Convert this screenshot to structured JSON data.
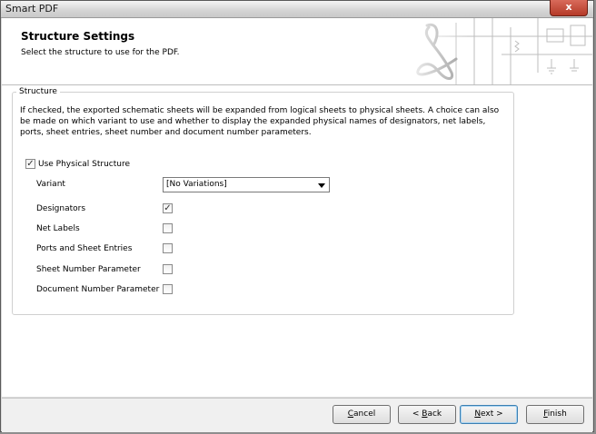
{
  "window": {
    "title": "Smart PDF",
    "close_label": "x"
  },
  "header": {
    "title": "Structure Settings",
    "subtitle": "Select the structure to use for the PDF."
  },
  "structure": {
    "legend": "Structure",
    "description": "If checked, the exported schematic sheets will be expanded from logical sheets to physical sheets. A choice can also be made on which variant to use and whether to display the expanded physical names of designators, net labels, ports, sheet entries, sheet number and document number parameters.",
    "use_physical": {
      "label": "Use Physical Structure",
      "checked": true
    },
    "variant": {
      "label": "Variant",
      "value": "[No Variations]"
    },
    "options": [
      {
        "label": "Designators",
        "checked": true
      },
      {
        "label": "Net Labels",
        "checked": false
      },
      {
        "label": "Ports and Sheet Entries",
        "checked": false
      },
      {
        "label": "Sheet Number Parameter",
        "checked": false
      },
      {
        "label": "Document Number Parameter",
        "checked": false
      }
    ]
  },
  "buttons": {
    "cancel": {
      "label": "Cancel",
      "accel": "C",
      "rest": "ancel"
    },
    "back": {
      "label": "< Back",
      "pre": "< ",
      "accel": "B",
      "rest": "ack"
    },
    "next": {
      "label": "Next >",
      "accel": "N",
      "rest": "ext >"
    },
    "finish": {
      "label": "Finish",
      "accel": "F",
      "rest": "inish"
    }
  },
  "check_glyph": "✓"
}
